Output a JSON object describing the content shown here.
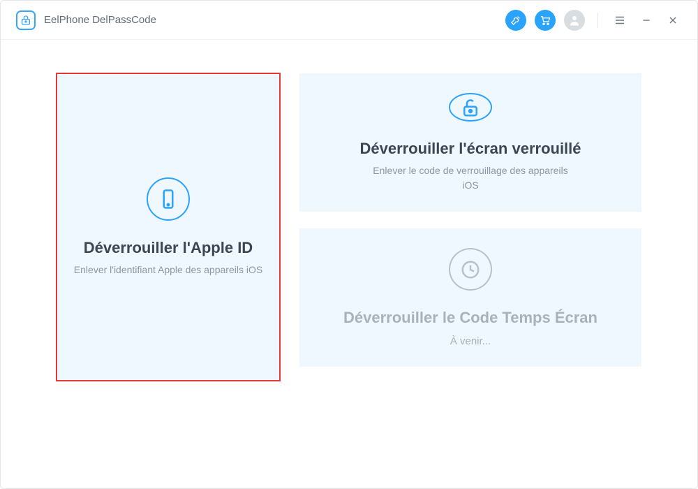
{
  "app": {
    "title": "EelPhone DelPassCode"
  },
  "cards": {
    "appleId": {
      "title": "Déverrouiller l'Apple ID",
      "desc": "Enlever l'identifiant Apple des appareils iOS"
    },
    "lockScreen": {
      "title": "Déverrouiller l'écran verrouillé",
      "desc": "Enlever le code de verrouillage des appareils iOS"
    },
    "screenTime": {
      "title": "Déverrouiller le Code Temps Écran",
      "comingSoon": "À venir..."
    }
  }
}
